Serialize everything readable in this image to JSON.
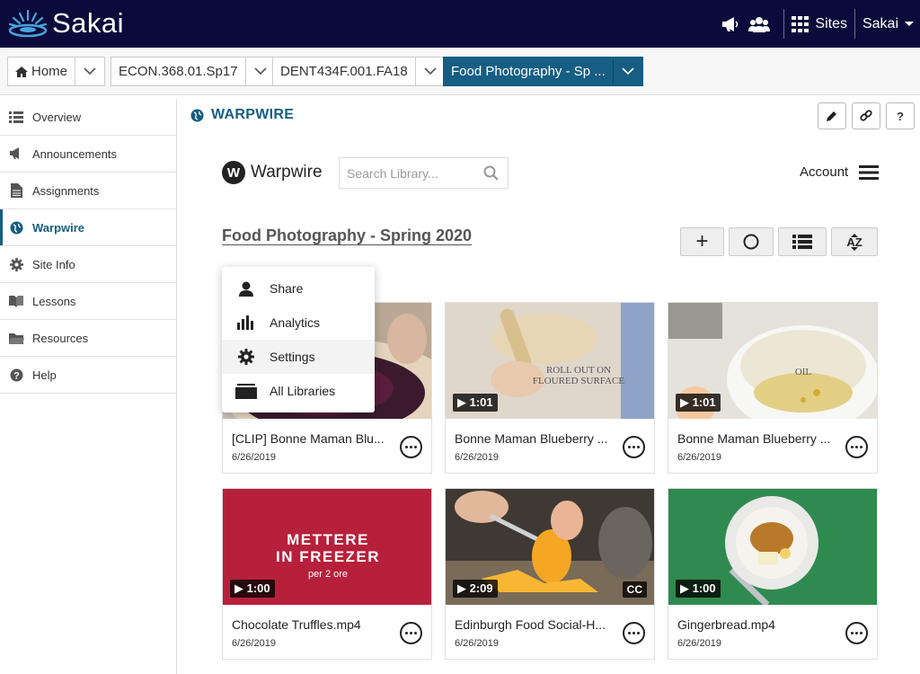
{
  "brand": {
    "name": "Sakai"
  },
  "topbar": {
    "sites_label": "Sites",
    "user_label": "Sakai"
  },
  "site_tabs": [
    {
      "label": "Home"
    },
    {
      "label": "ECON.368.01.Sp17"
    },
    {
      "label": "DENT434F.001.FA18"
    },
    {
      "label": "Food Photography - Sp ..."
    }
  ],
  "sidebar": {
    "items": [
      {
        "label": "Overview",
        "icon": "list-icon"
      },
      {
        "label": "Announcements",
        "icon": "megaphone-icon"
      },
      {
        "label": "Assignments",
        "icon": "file-icon"
      },
      {
        "label": "Warpwire",
        "icon": "globe-icon"
      },
      {
        "label": "Site Info",
        "icon": "gear-icon"
      },
      {
        "label": "Lessons",
        "icon": "book-icon"
      },
      {
        "label": "Resources",
        "icon": "folder-icon"
      },
      {
        "label": "Help",
        "icon": "question-icon"
      }
    ]
  },
  "tool": {
    "title": "WARPWIRE",
    "edit_icon": "pencil-icon",
    "link_icon": "link-icon",
    "help_label": "?"
  },
  "warpwire": {
    "logo_letter": "W",
    "brand": "Warpwire",
    "search_placeholder": "Search Library...",
    "account_label": "Account"
  },
  "library": {
    "title": "Food Photography - Spring 2020",
    "buttons": {
      "add": "+",
      "sort": "AZ"
    }
  },
  "menu": {
    "items": [
      {
        "label": "Share",
        "icon": "person-icon"
      },
      {
        "label": "Analytics",
        "icon": "bar-chart-icon"
      },
      {
        "label": "Settings",
        "icon": "gear-icon"
      },
      {
        "label": "All Libraries",
        "icon": "library-icon"
      }
    ]
  },
  "media": [
    {
      "title": "[CLIP] Bonne Maman Blu...",
      "date": "6/26/2019",
      "duration": "",
      "cc": ""
    },
    {
      "title": "Bonne Maman Blueberry ...",
      "date": "6/26/2019",
      "duration": "1:01",
      "cc": "",
      "overlay": "ROLL OUT ON\nFLOURED SURFACE"
    },
    {
      "title": "Bonne Maman Blueberry ...",
      "date": "6/26/2019",
      "duration": "1:01",
      "cc": "",
      "overlay": "OIL"
    },
    {
      "title": "Chocolate Truffles.mp4",
      "date": "6/26/2019",
      "duration": "1:00",
      "cc": "",
      "overlay_main": "METTERE\nIN FREEZER",
      "overlay_sub": "per 2 ore"
    },
    {
      "title": "Edinburgh Food Social-H...",
      "date": "6/26/2019",
      "duration": "2:09",
      "cc": "CC"
    },
    {
      "title": "Gingerbread.mp4",
      "date": "6/26/2019",
      "duration": "1:00",
      "cc": ""
    }
  ],
  "colors": {
    "topbar": "#0b0b3b",
    "accent": "#165e83",
    "swirl": "#4aa3df"
  }
}
